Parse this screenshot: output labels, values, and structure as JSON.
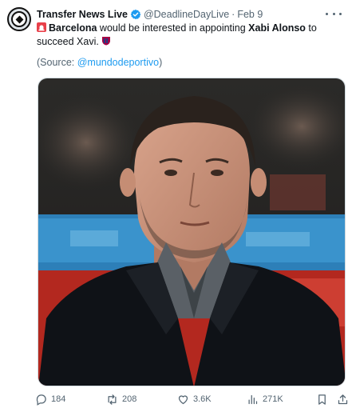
{
  "account": {
    "name": "Transfer News Live",
    "handle": "@DeadlineDayLive",
    "separator": "·",
    "date": "Feb 9"
  },
  "tweet": {
    "part1": "Barcelona",
    "part2": " would be interested in appointing ",
    "part3": "Xabi Alonso",
    "part4": " to succeed Xavi.",
    "source_prefix": "(Source: ",
    "source_link": "@mundodeportivo",
    "source_suffix": ")"
  },
  "metrics": {
    "replies": "184",
    "retweets": "208",
    "likes": "3.6K",
    "views": "271K"
  },
  "icons": {
    "reply": "reply-icon",
    "retweet": "retweet-icon",
    "like": "heart-icon",
    "views": "views-icon",
    "bookmark": "bookmark-icon",
    "share": "share-icon",
    "verified": "verified-badge-icon",
    "more": "more-options-icon"
  },
  "colors": {
    "accent": "#1d9bf0",
    "secondary_text": "#536471"
  }
}
